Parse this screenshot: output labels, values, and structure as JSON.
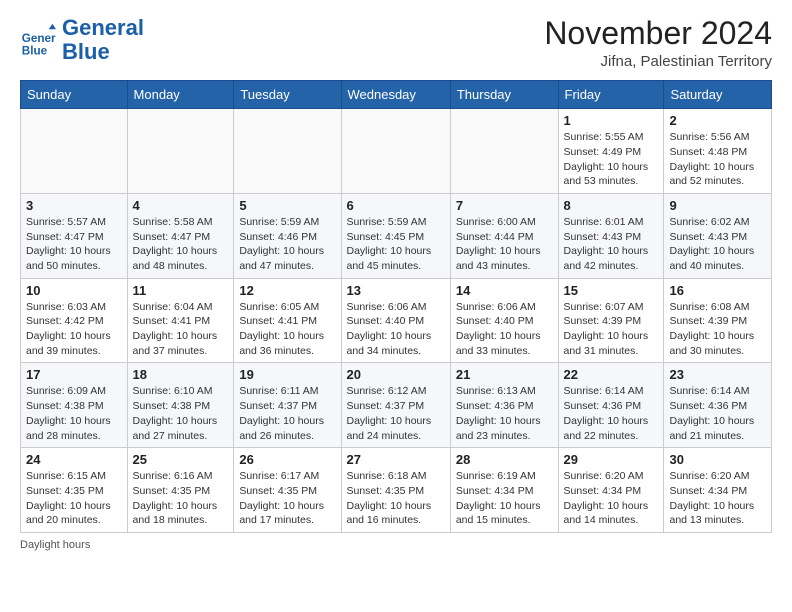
{
  "header": {
    "logo_line1": "General",
    "logo_line2": "Blue",
    "month": "November 2024",
    "location": "Jifna, Palestinian Territory"
  },
  "weekdays": [
    "Sunday",
    "Monday",
    "Tuesday",
    "Wednesday",
    "Thursday",
    "Friday",
    "Saturday"
  ],
  "weeks": [
    [
      {
        "day": "",
        "detail": ""
      },
      {
        "day": "",
        "detail": ""
      },
      {
        "day": "",
        "detail": ""
      },
      {
        "day": "",
        "detail": ""
      },
      {
        "day": "",
        "detail": ""
      },
      {
        "day": "1",
        "detail": "Sunrise: 5:55 AM\nSunset: 4:49 PM\nDaylight: 10 hours\nand 53 minutes."
      },
      {
        "day": "2",
        "detail": "Sunrise: 5:56 AM\nSunset: 4:48 PM\nDaylight: 10 hours\nand 52 minutes."
      }
    ],
    [
      {
        "day": "3",
        "detail": "Sunrise: 5:57 AM\nSunset: 4:47 PM\nDaylight: 10 hours\nand 50 minutes."
      },
      {
        "day": "4",
        "detail": "Sunrise: 5:58 AM\nSunset: 4:47 PM\nDaylight: 10 hours\nand 48 minutes."
      },
      {
        "day": "5",
        "detail": "Sunrise: 5:59 AM\nSunset: 4:46 PM\nDaylight: 10 hours\nand 47 minutes."
      },
      {
        "day": "6",
        "detail": "Sunrise: 5:59 AM\nSunset: 4:45 PM\nDaylight: 10 hours\nand 45 minutes."
      },
      {
        "day": "7",
        "detail": "Sunrise: 6:00 AM\nSunset: 4:44 PM\nDaylight: 10 hours\nand 43 minutes."
      },
      {
        "day": "8",
        "detail": "Sunrise: 6:01 AM\nSunset: 4:43 PM\nDaylight: 10 hours\nand 42 minutes."
      },
      {
        "day": "9",
        "detail": "Sunrise: 6:02 AM\nSunset: 4:43 PM\nDaylight: 10 hours\nand 40 minutes."
      }
    ],
    [
      {
        "day": "10",
        "detail": "Sunrise: 6:03 AM\nSunset: 4:42 PM\nDaylight: 10 hours\nand 39 minutes."
      },
      {
        "day": "11",
        "detail": "Sunrise: 6:04 AM\nSunset: 4:41 PM\nDaylight: 10 hours\nand 37 minutes."
      },
      {
        "day": "12",
        "detail": "Sunrise: 6:05 AM\nSunset: 4:41 PM\nDaylight: 10 hours\nand 36 minutes."
      },
      {
        "day": "13",
        "detail": "Sunrise: 6:06 AM\nSunset: 4:40 PM\nDaylight: 10 hours\nand 34 minutes."
      },
      {
        "day": "14",
        "detail": "Sunrise: 6:06 AM\nSunset: 4:40 PM\nDaylight: 10 hours\nand 33 minutes."
      },
      {
        "day": "15",
        "detail": "Sunrise: 6:07 AM\nSunset: 4:39 PM\nDaylight: 10 hours\nand 31 minutes."
      },
      {
        "day": "16",
        "detail": "Sunrise: 6:08 AM\nSunset: 4:39 PM\nDaylight: 10 hours\nand 30 minutes."
      }
    ],
    [
      {
        "day": "17",
        "detail": "Sunrise: 6:09 AM\nSunset: 4:38 PM\nDaylight: 10 hours\nand 28 minutes."
      },
      {
        "day": "18",
        "detail": "Sunrise: 6:10 AM\nSunset: 4:38 PM\nDaylight: 10 hours\nand 27 minutes."
      },
      {
        "day": "19",
        "detail": "Sunrise: 6:11 AM\nSunset: 4:37 PM\nDaylight: 10 hours\nand 26 minutes."
      },
      {
        "day": "20",
        "detail": "Sunrise: 6:12 AM\nSunset: 4:37 PM\nDaylight: 10 hours\nand 24 minutes."
      },
      {
        "day": "21",
        "detail": "Sunrise: 6:13 AM\nSunset: 4:36 PM\nDaylight: 10 hours\nand 23 minutes."
      },
      {
        "day": "22",
        "detail": "Sunrise: 6:14 AM\nSunset: 4:36 PM\nDaylight: 10 hours\nand 22 minutes."
      },
      {
        "day": "23",
        "detail": "Sunrise: 6:14 AM\nSunset: 4:36 PM\nDaylight: 10 hours\nand 21 minutes."
      }
    ],
    [
      {
        "day": "24",
        "detail": "Sunrise: 6:15 AM\nSunset: 4:35 PM\nDaylight: 10 hours\nand 20 minutes."
      },
      {
        "day": "25",
        "detail": "Sunrise: 6:16 AM\nSunset: 4:35 PM\nDaylight: 10 hours\nand 18 minutes."
      },
      {
        "day": "26",
        "detail": "Sunrise: 6:17 AM\nSunset: 4:35 PM\nDaylight: 10 hours\nand 17 minutes."
      },
      {
        "day": "27",
        "detail": "Sunrise: 6:18 AM\nSunset: 4:35 PM\nDaylight: 10 hours\nand 16 minutes."
      },
      {
        "day": "28",
        "detail": "Sunrise: 6:19 AM\nSunset: 4:34 PM\nDaylight: 10 hours\nand 15 minutes."
      },
      {
        "day": "29",
        "detail": "Sunrise: 6:20 AM\nSunset: 4:34 PM\nDaylight: 10 hours\nand 14 minutes."
      },
      {
        "day": "30",
        "detail": "Sunrise: 6:20 AM\nSunset: 4:34 PM\nDaylight: 10 hours\nand 13 minutes."
      }
    ]
  ],
  "footer": {
    "note": "Daylight hours"
  }
}
